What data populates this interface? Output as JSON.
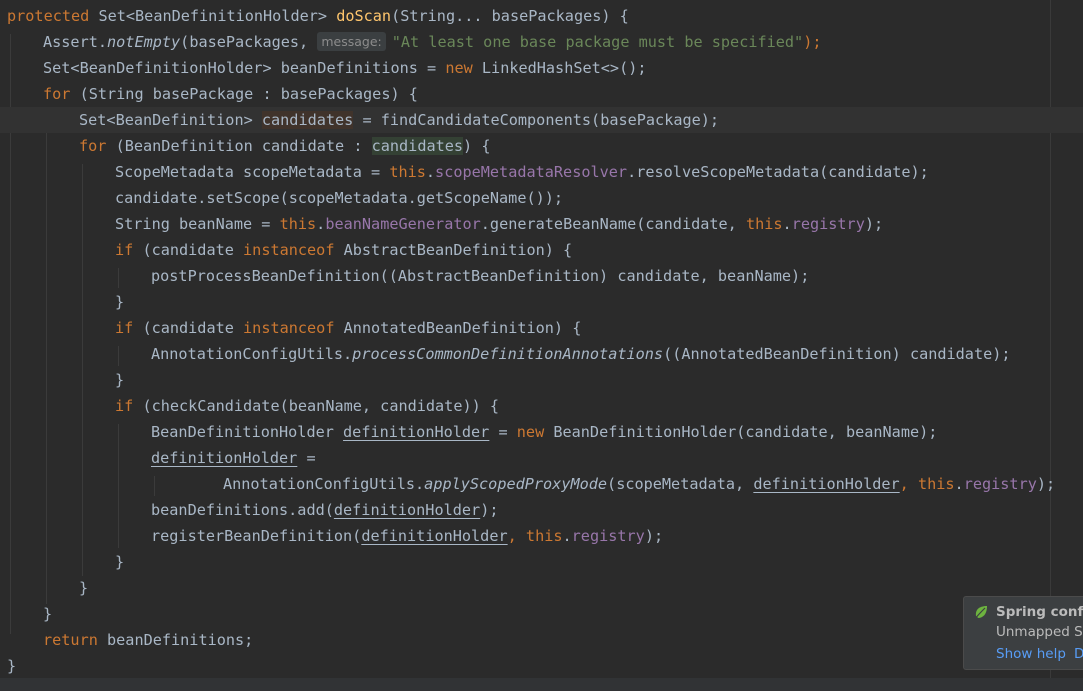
{
  "editor": {
    "code": {
      "line1": {
        "kw": "protected",
        "set": "Set<BeanDefinitionHolder>",
        "method": "doScan",
        "params": "(String... basePackages) {"
      },
      "line2": {
        "cls": "Assert.",
        "call": "notEmpty",
        "args_open": "(basePackages,",
        "hint": "message:",
        "str": "\"At least one base package must be specified\"",
        "close": ");"
      },
      "line3": {
        "decl": "Set<BeanDefinitionHolder> beanDefinitions = ",
        "kw": "new",
        "rest": " LinkedHashSet<>();"
      },
      "line4": {
        "kw": "for",
        "rest": " (String basePackage : basePackages) {"
      },
      "line5": {
        "type": "Set<BeanDefinition> ",
        "var": "candidates",
        "rest": " = findCandidateComponents(basePackage);"
      },
      "line6": {
        "kw": "for",
        "mid": " (BeanDefinition candidate : ",
        "var": "candidates",
        "end": ") {"
      },
      "line7": {
        "decl": "ScopeMetadata scopeMetadata = ",
        "kw": "this",
        "dot": ".",
        "field": "scopeMetadataResolver",
        "rest": ".resolveScopeMetadata(candidate);"
      },
      "line8": {
        "text": "candidate.setScope(scopeMetadata.getScopeName());"
      },
      "line9": {
        "decl": "String beanName = ",
        "kw": "this",
        "dot": ".",
        "field": "beanNameGenerator",
        "mid": ".generateBeanName(candidate, ",
        "kw2": "this",
        "dot2": ".",
        "field2": "registry",
        "end": ");"
      },
      "line10": {
        "kw": "if",
        "mid": " (candidate ",
        "kw2": "instanceof",
        "end": " AbstractBeanDefinition) {"
      },
      "line11": {
        "text": "postProcessBeanDefinition((AbstractBeanDefinition) candidate, beanName);"
      },
      "line12": {
        "text": "}"
      },
      "line13": {
        "kw": "if",
        "mid": " (candidate ",
        "kw2": "instanceof",
        "end": " AnnotatedBeanDefinition) {"
      },
      "line14": {
        "cls": "AnnotationConfigUtils.",
        "call": "processCommonDefinitionAnnotations",
        "end": "((AnnotatedBeanDefinition) candidate);"
      },
      "line15": {
        "text": "}"
      },
      "line16": {
        "kw": "if",
        "rest": " (checkCandidate(beanName, candidate)) {"
      },
      "line17": {
        "type": "BeanDefinitionHolder ",
        "var": "definitionHolder",
        "eq": " = ",
        "kw": "new",
        "rest": " BeanDefinitionHolder(candidate, beanName);"
      },
      "line18": {
        "var": "definitionHolder",
        "rest": " ="
      },
      "line19": {
        "cls": "AnnotationConfigUtils.",
        "call": "applyScopedProxyMode",
        "mid": "(scopeMetadata, ",
        "var": "definitionHolder",
        "comma": ", ",
        "kw": "this",
        "dot": ".",
        "field": "registry",
        "end": ");"
      },
      "line20": {
        "pre": "beanDefinitions.add(",
        "var": "definitionHolder",
        "end": ");"
      },
      "line21": {
        "pre": "registerBeanDefinition(",
        "var": "definitionHolder",
        "comma": ", ",
        "kw": "this",
        "dot": ".",
        "field": "registry",
        "end": ");"
      },
      "line22": {
        "text": "}"
      },
      "line23": {
        "text": "}"
      },
      "line24": {
        "text": "}"
      },
      "line25": {
        "kw": "return",
        "rest": " beanDefinitions;"
      },
      "line26": {
        "text": "}"
      }
    }
  },
  "notification": {
    "icon": "spring-leaf-icon",
    "title": "Spring config",
    "body": "Unmapped Spr",
    "show_help": "Show help",
    "more": "D"
  },
  "colors": {
    "background": "#2b2b2b",
    "keyword": "#cc7832",
    "method_decl": "#ffc66d",
    "string": "#6a8759",
    "field": "#9876aa",
    "link": "#589df6"
  }
}
